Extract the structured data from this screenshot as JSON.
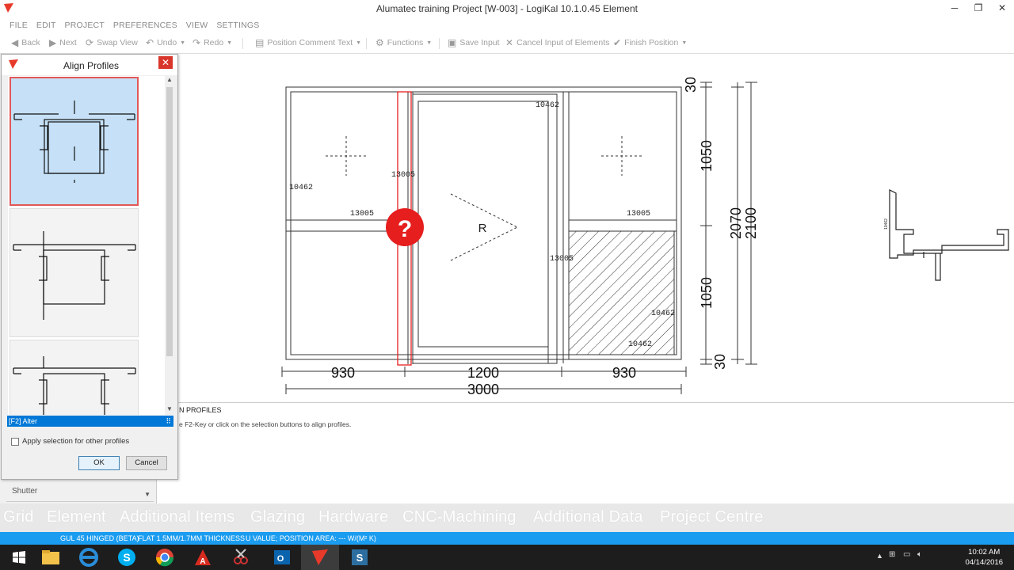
{
  "window": {
    "title": "Alumatec training Project [W-003] - LogiKal 10.1.0.45 Element",
    "min": "─",
    "max": "❐",
    "close": "✕"
  },
  "menu": [
    "FILE",
    "EDIT",
    "PROJECT",
    "PREFERENCES",
    "VIEW",
    "SETTINGS"
  ],
  "toolbar": {
    "back": "Back",
    "next": "Next",
    "swap": "Swap View",
    "undo": "Undo",
    "redo": "Redo",
    "comment": "Position Comment Text",
    "functions": "Functions",
    "save": "Save Input",
    "cancel": "Cancel Input of Elements",
    "finish": "Finish Position"
  },
  "dialog": {
    "title": "Align Profiles",
    "close": "✕",
    "status": "[F2] Alter",
    "apply_label": "Apply selection for other profiles",
    "ok": "OK",
    "cancel": "Cancel"
  },
  "shutter": {
    "label": "Shutter"
  },
  "drawing": {
    "labels": {
      "p1": "10462",
      "p2": "13005",
      "p3": "10462",
      "p4": "13005",
      "p5": "13005",
      "p6": "13005",
      "p7": "10462",
      "p8": "10462",
      "opening": "R"
    },
    "dims": {
      "d930a": "930",
      "d1200": "1200",
      "d930b": "930",
      "d3000": "3000",
      "d30top": "30",
      "d1050a": "1050",
      "d1050b": "1050",
      "d30bot": "30",
      "d2070": "2070",
      "d2100": "2100"
    },
    "section_label": "10462"
  },
  "info": {
    "heading": "N PROFILES",
    "text": "e F2-Key or click on the selection buttons to align profiles."
  },
  "tabs": [
    "Grid",
    "Element",
    "Additional Items",
    "Glazing",
    "Hardware",
    "CNC-Machining",
    "Additional Data",
    "Project Centre"
  ],
  "status": {
    "s1": "GUL 45 HINGED (BETA)",
    "s2": "FLAT 1.5MM/1.7MM THICKNESS",
    "s3": "U VALUE; POSITION AREA: --- W/(M² K)"
  },
  "clock": {
    "time": "10:02 AM",
    "date": "04/14/2016"
  },
  "colors": {
    "accent": "#0078d7",
    "status": "#1a9cf0",
    "selection": "#c6e1f7",
    "marker": "#e61e1e"
  }
}
